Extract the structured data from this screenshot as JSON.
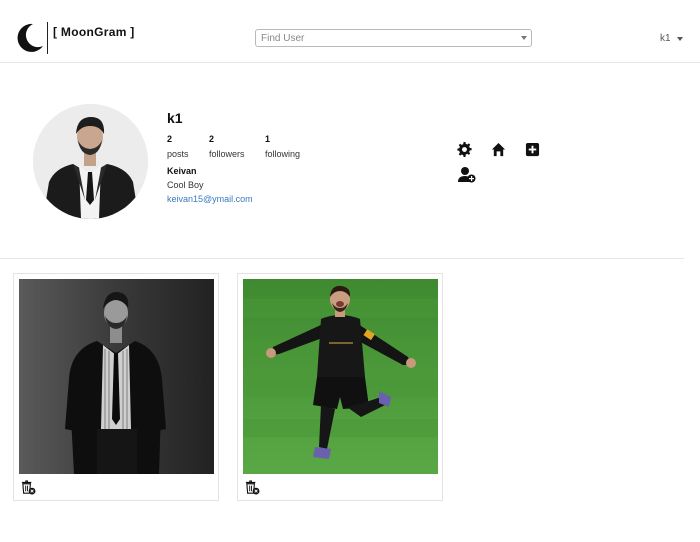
{
  "header": {
    "brand": "[ MoonGram ]",
    "search_placeholder": "Find User",
    "user_menu": "k1"
  },
  "profile": {
    "username": "k1",
    "stats": [
      {
        "count": "2",
        "label": "posts"
      },
      {
        "count": "2",
        "label": "followers"
      },
      {
        "count": "1",
        "label": "following"
      }
    ],
    "full_name": "Keivan",
    "bio": "Cool Boy",
    "email": "keivan15@ymail.com"
  },
  "actions": [
    "gear-icon",
    "home-icon",
    "plus-square-icon",
    "user-add-icon"
  ],
  "posts": [
    {
      "subject": "man in black coat and white striped shirt, black and white portrait",
      "action_icon": "trash-delete-icon"
    },
    {
      "subject": "football player in black kit celebrating on grass pitch",
      "action_icon": "trash-delete-icon"
    }
  ],
  "colors": {
    "link": "#3a7bbf",
    "border": "#e3e3e3",
    "pitch_green": "#4e9a3a"
  }
}
